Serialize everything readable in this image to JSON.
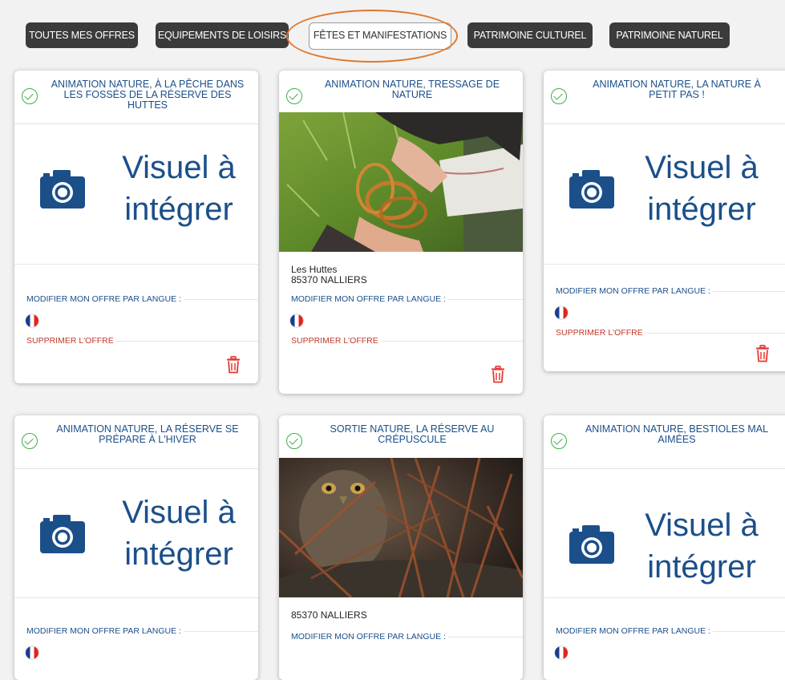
{
  "filters": [
    {
      "label": "TOUTES MES OFFRES",
      "active": false
    },
    {
      "label": "EQUIPEMENTS DE LOISIRS",
      "active": false
    },
    {
      "label": "FÊTES ET MANIFESTATIONS",
      "active": true
    },
    {
      "label": "PATRIMOINE CULTUREL",
      "active": false
    },
    {
      "label": "PATRIMOINE NATUREL",
      "active": false
    }
  ],
  "common": {
    "placeholder_line1": "Visuel à",
    "placeholder_line2": "intégrer",
    "modify_label": "MODIFIER MON OFFRE PAR LANGUE :",
    "delete_label": "SUPPRIMER L'OFFRE",
    "language_flag": "flag-fr-icon"
  },
  "cards": [
    {
      "title": "ANIMATION NATURE, À LA PÊCHE DANS LES FOSSÉS DE LA RÉSERVE DES HUTTES",
      "visual": "placeholder",
      "address_line1": "",
      "address_line2": ""
    },
    {
      "title": "ANIMATION NATURE, TRESSAGE DE NATURE",
      "visual": "photo-hands-weaving",
      "address_line1": "Les Huttes",
      "address_line2": "85370 NALLIERS"
    },
    {
      "title": "ANIMATION NATURE, LA NATURE À PETIT PAS !",
      "visual": "placeholder",
      "address_line1": "",
      "address_line2": ""
    },
    {
      "title": "ANIMATION NATURE, LA RÉSERVE SE PRÉPARE À L'HIVER",
      "visual": "placeholder",
      "address_line1": "",
      "address_line2": ""
    },
    {
      "title": "SORTIE NATURE, LA RÉSERVE AU CRÉPUSCULE",
      "visual": "photo-owl",
      "address_line1": "85370 NALLIERS",
      "address_line2": ""
    },
    {
      "title": "ANIMATION NATURE, BESTIOLES MAL AIMÉES",
      "visual": "placeholder",
      "address_line1": "",
      "address_line2": ""
    }
  ],
  "colors": {
    "title_blue": "#1b4f8a",
    "check_green": "#3fae49",
    "delete_red": "#e53935",
    "highlight": "#e0782f"
  }
}
